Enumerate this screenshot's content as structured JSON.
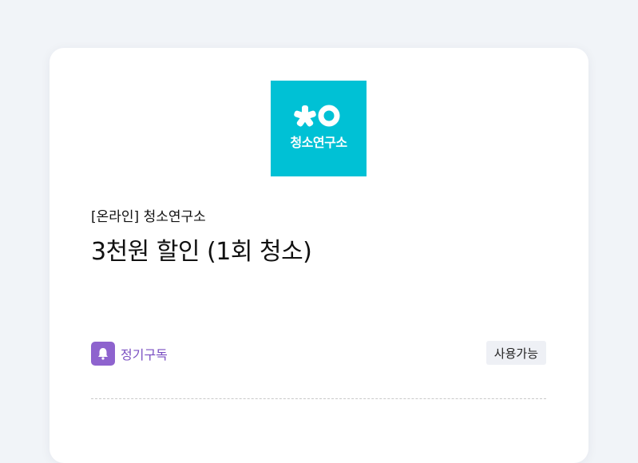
{
  "brand": {
    "logo_text": "청소연구소",
    "logo_color": "#00c1d5"
  },
  "coupon": {
    "subtitle": "[온라인] 청소연구소",
    "title": "3천원 할인 (1회 청소)",
    "subscription_label": "정기구독",
    "subscription_icon": "bell-icon",
    "status": "사용가능"
  },
  "colors": {
    "accent_purple": "#8e63ce",
    "background": "#f1f4f8"
  }
}
